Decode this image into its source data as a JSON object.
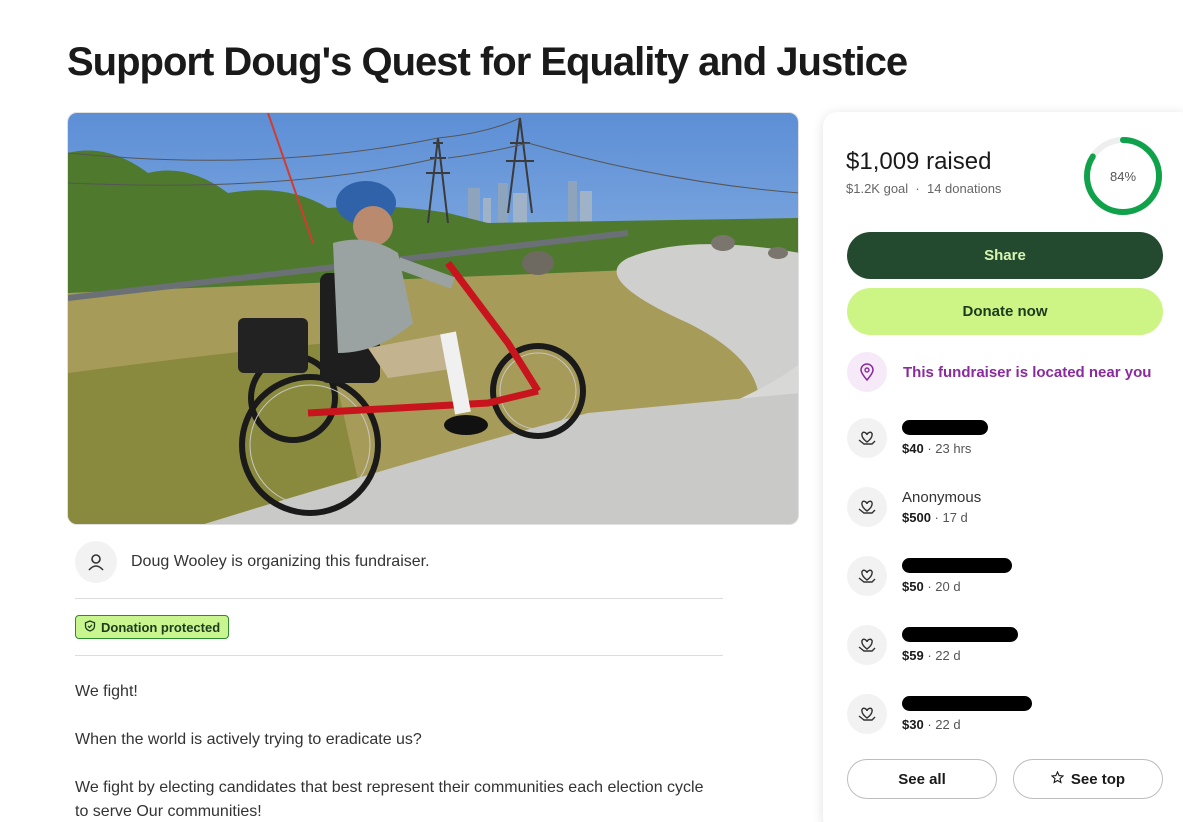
{
  "page": {
    "title": "Support Doug's Quest for Equality and Justice"
  },
  "organizer": {
    "text": "Doug Wooley is organizing this fundraiser."
  },
  "badge": {
    "label": "Donation protected"
  },
  "story": {
    "p1": "We fight!",
    "p2": "When the world is actively trying to eradicate us?",
    "p3": "We fight by electing candidates that best represent their communities each election cycle to serve Our communities!"
  },
  "summary": {
    "raised": "$1,009 raised",
    "goal": "$1.2K goal",
    "separator": "·",
    "donations": "14 donations",
    "progress_label": "84%",
    "progress_fraction": 0.84
  },
  "actions": {
    "share": "Share",
    "donate": "Donate now",
    "see_all": "See all",
    "see_top": "See top"
  },
  "location": {
    "text": "This fundraiser is located near you"
  },
  "donations": [
    {
      "name": "",
      "amount": "$40",
      "time": "· 23 hrs"
    },
    {
      "name": "Anonymous",
      "amount": "$500",
      "time": "· 17 d"
    },
    {
      "name": "",
      "amount": "$50",
      "time": "· 20 d"
    },
    {
      "name": "",
      "amount": "$59",
      "time": "· 22 d"
    },
    {
      "name": "",
      "amount": "$30",
      "time": "· 22 d"
    }
  ],
  "colors": {
    "brand_green": "#234a2f",
    "donate_green": "#cdf585",
    "ring_green": "#0fa24a",
    "location_purple": "#8a2a9e"
  },
  "icons": [
    "user-icon",
    "shield-icon",
    "location-pin-icon",
    "heart-hand-icon",
    "star-icon"
  ]
}
